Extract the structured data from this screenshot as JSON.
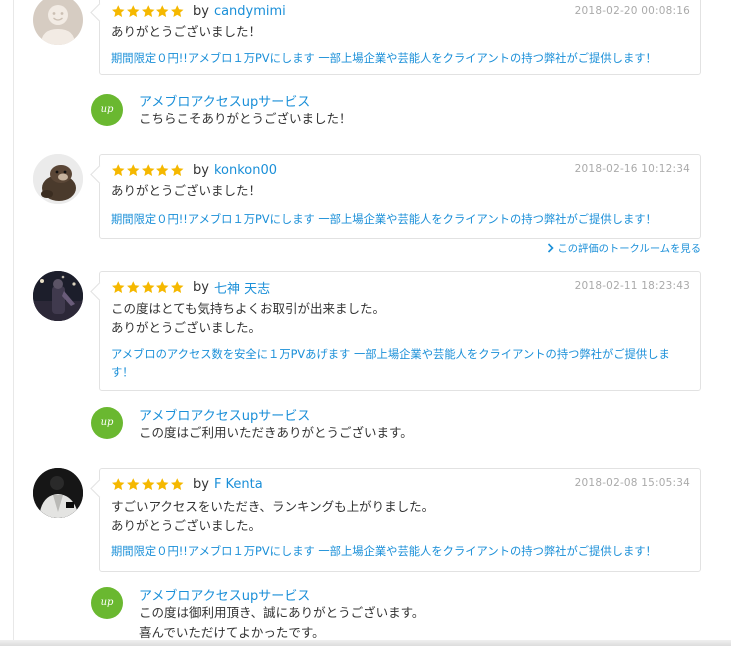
{
  "reviews": [
    {
      "username": "candymimi",
      "by": "by",
      "rating": 5,
      "date": "2018-02-20 00:08:16",
      "comment": "ありがとうございました！",
      "service": "期間限定０円!!アメブロ１万PVにします 一部上場企業や芸能人をクライアントの持つ弊社がご提供します！",
      "reply": {
        "seller": "アメブロアクセスupサービス",
        "text": "こちらこそありがとうございました！"
      }
    },
    {
      "username": "konkon00",
      "by": "by",
      "rating": 5,
      "date": "2018-02-16 10:12:34",
      "comment": "ありがとうございました！",
      "service": "期間限定０円!!アメブロ１万PVにします 一部上場企業や芸能人をクライアントの持つ弊社がご提供します！",
      "talkroom_link": "この評価のトークルームを見る"
    },
    {
      "username": "七神 天志",
      "by": "by",
      "rating": 5,
      "date": "2018-02-11 18:23:43",
      "comment_lines": [
        "この度はとても気持ちよくお取引が出来ました。",
        "ありがとうございました。"
      ],
      "service_lines": [
        "アメブロのアクセス数を安全に１万PVあげます 一部上場企業や芸能人をクライアントの持つ弊社がご提供しま",
        "す！"
      ],
      "reply": {
        "seller": "アメブロアクセスupサービス",
        "text": "この度はご利用いただきありがとうございます。"
      }
    },
    {
      "username": "F Kenta",
      "by": "by",
      "rating": 5,
      "date": "2018-02-08 15:05:34",
      "comment_lines": [
        "すごいアクセスをいただき、ランキングも上がりました。",
        "ありがとうございました。"
      ],
      "service": "期間限定０円!!アメブロ１万PVにします 一部上場企業や芸能人をクライアントの持つ弊社がご提供します！",
      "reply": {
        "seller": "アメブロアクセスupサービス",
        "text_lines": [
          "この度は御利用頂き、誠にありがとうございます。",
          "喜んでいただけてよかったです。"
        ]
      }
    }
  ],
  "seller_icon_text": "up",
  "colors": {
    "link": "#1a8fd8",
    "star": "#f5b800",
    "seller_icon": "#6ab830",
    "date": "#aaaaaa",
    "border": "#e2e2e2"
  },
  "icons": {
    "star": "star-icon",
    "chevron": "chevron-right-icon",
    "seller": "seller-logo-icon"
  }
}
